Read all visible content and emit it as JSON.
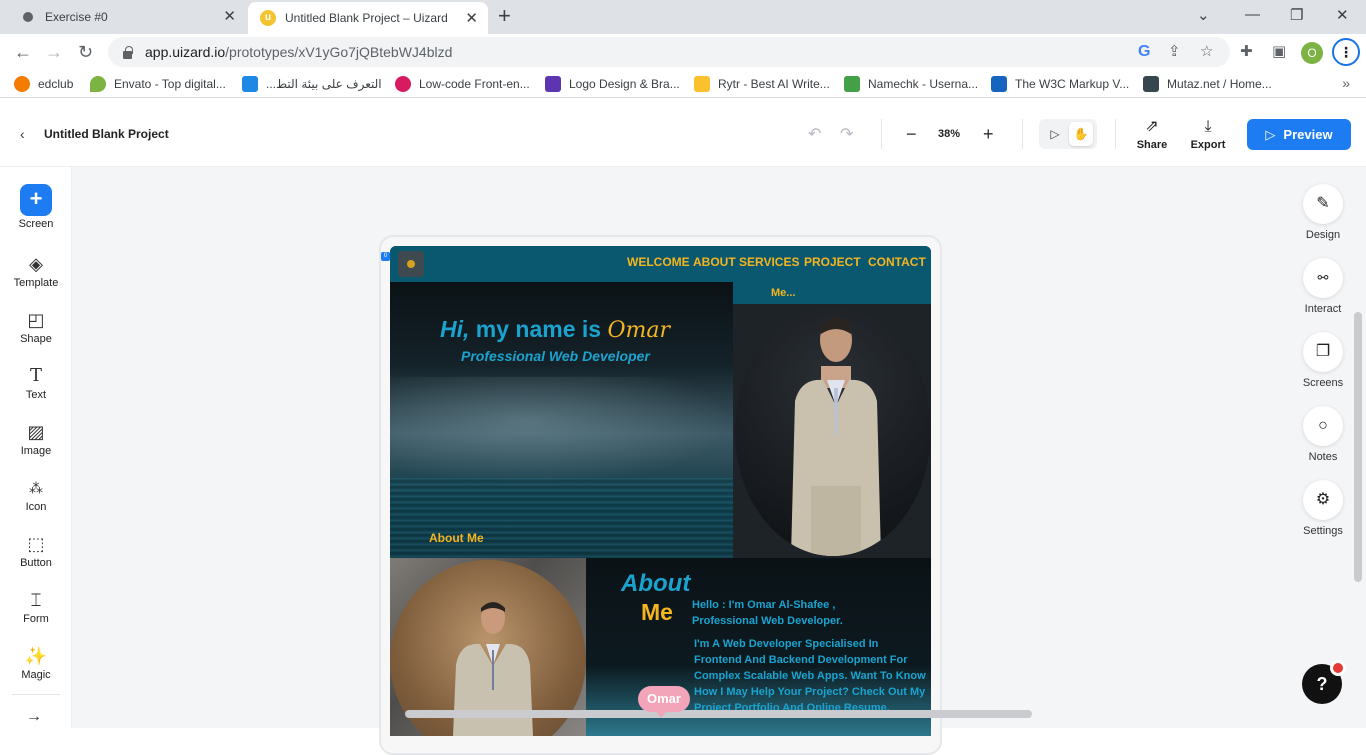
{
  "browser": {
    "tabs": [
      {
        "title": "Exercise #0",
        "active": false
      },
      {
        "title": "Untitled Blank Project – Uizard",
        "active": true
      }
    ],
    "url_host": "app.uizard.io",
    "url_path": "/prototypes/xV1yGo7jQBtebWJ4blzd",
    "profile_initial": "O",
    "bookmarks": [
      {
        "label": "edclub",
        "icon": "edclub-icon",
        "color": "#f57c00"
      },
      {
        "label": "Envato - Top digital...",
        "icon": "envato-icon",
        "color": "#7cb342"
      },
      {
        "label": "...التعرف على بيئة التط",
        "icon": "bookmark-blue-icon",
        "color": "#1e88e5"
      },
      {
        "label": "Low-code Front-en...",
        "icon": "lowcode-icon",
        "color": "#d81b60"
      },
      {
        "label": "Logo Design & Bra...",
        "icon": "logo-design-icon",
        "color": "#5e35b1"
      },
      {
        "label": "Rytr - Best AI Write...",
        "icon": "rytr-icon",
        "color": "#fbc02d"
      },
      {
        "label": "Namechk - Userna...",
        "icon": "namechk-icon",
        "color": "#43a047"
      },
      {
        "label": "The W3C Markup V...",
        "icon": "w3c-icon",
        "color": "#1565c0"
      },
      {
        "label": "Mutaz.net / Home...",
        "icon": "mutaz-icon",
        "color": "#37474f"
      }
    ]
  },
  "uizard": {
    "project_title": "Untitled Blank Project",
    "zoom": "38%",
    "share_label": "Share",
    "export_label": "Export",
    "preview_label": "Preview",
    "left_tools": [
      "Screen",
      "Template",
      "Shape",
      "Text",
      "Image",
      "Icon",
      "Button",
      "Form",
      "Magic"
    ],
    "right_tools": [
      "Design",
      "Interact",
      "Screens",
      "Notes",
      "Settings"
    ],
    "help_label": "?",
    "cursor_user": "Omar"
  },
  "site": {
    "nav": [
      "WELCOME",
      "ABOUT",
      "SERVICES",
      "PROJECT",
      "CONTACT"
    ],
    "nav_sub": "Me...",
    "hero_hi": "Hi,",
    "hero_myname": "my name is",
    "hero_name": "Omar",
    "hero_sub": "Professional Web Developer",
    "about_link": "About Me",
    "about_title": "About",
    "about_me": "Me",
    "about_hello": "Hello : I'm Omar Al-Shafee , Professional Web Developer.",
    "about_body": "I'm A Web Developer Specialised In Frontend And Backend Development For Complex Scalable Web Apps. Want To Know How I May Help Your Project? Check Out My Project Portfolio And Online Resume."
  }
}
